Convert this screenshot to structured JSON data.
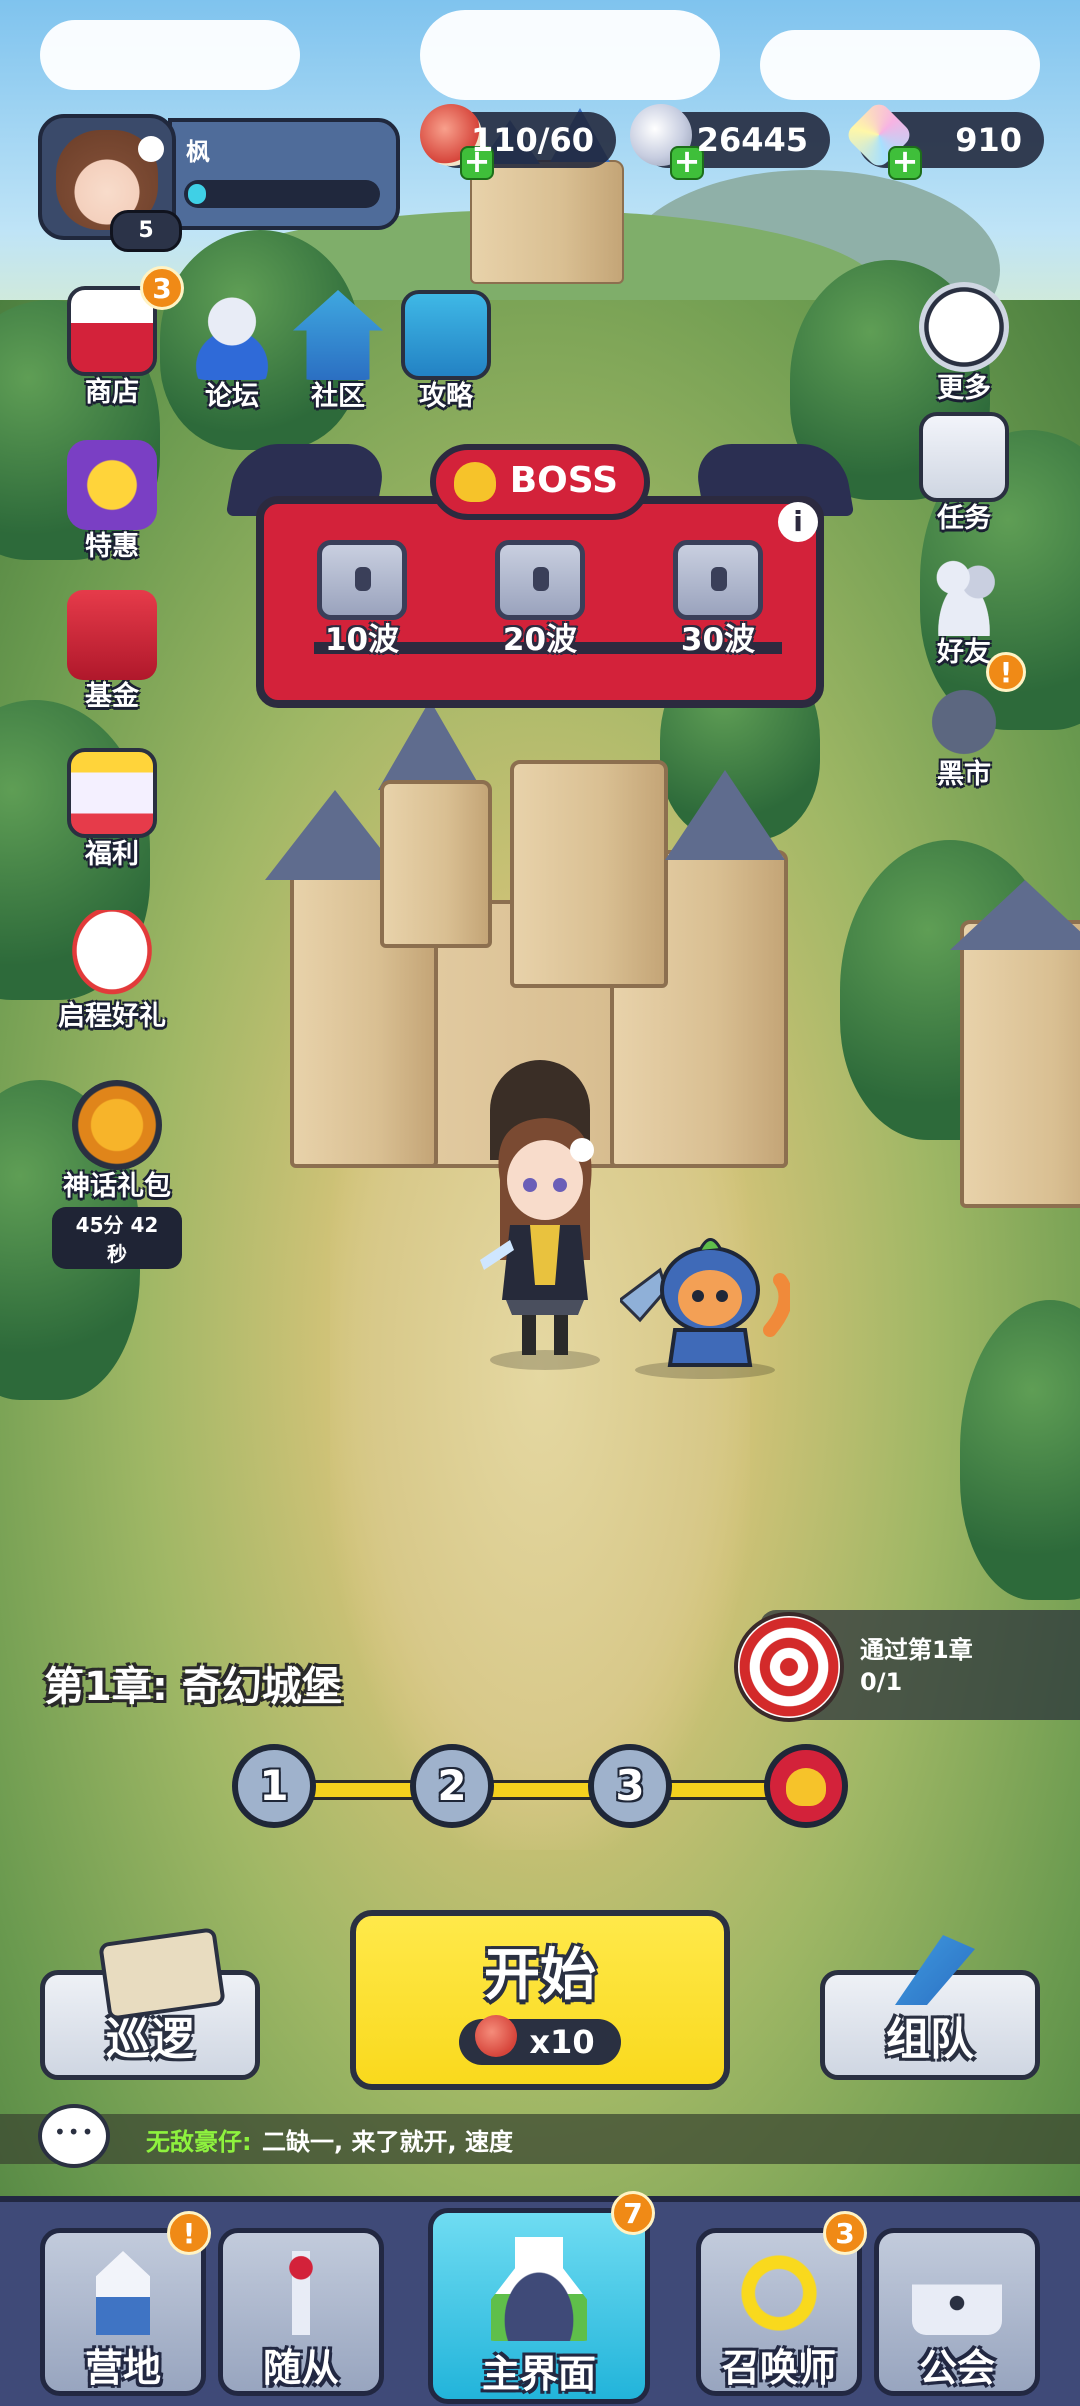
{
  "player": {
    "name": "枫",
    "level": "5",
    "xp_fraction": 0.06
  },
  "resources": [
    {
      "name": "stamina",
      "icon": "meat-icon",
      "value": "110/60",
      "color": "#d6443a"
    },
    {
      "name": "silver",
      "icon": "silver-ore-icon",
      "value": "26445",
      "color": "#cfd6e2"
    },
    {
      "name": "diamond",
      "icon": "diamond-icon",
      "value": "910",
      "color": "#f0a0d8"
    }
  ],
  "top_buttons": [
    {
      "label": "商店",
      "badge": "3"
    },
    {
      "label": "论坛"
    },
    {
      "label": "社区"
    },
    {
      "label": "攻略"
    }
  ],
  "left_buttons": [
    {
      "label": "特惠"
    },
    {
      "label": "基金"
    },
    {
      "label": "福利"
    },
    {
      "label": "启程好礼"
    },
    {
      "label": "神话礼包",
      "timer": "45分 42秒"
    }
  ],
  "right_buttons": [
    {
      "label": "更多"
    },
    {
      "label": "任务"
    },
    {
      "label": "好友"
    },
    {
      "label": "黑市",
      "badge": "!"
    }
  ],
  "boss_panel": {
    "title": "BOSS",
    "info": "i",
    "chests": [
      "10波",
      "20波",
      "30波"
    ]
  },
  "chapter": {
    "title": "第1章: 奇幻城堡",
    "stages": [
      "1",
      "2",
      "3"
    ],
    "current_boss_stage": true
  },
  "quest": {
    "text": "通过第1章",
    "progress": "0/1"
  },
  "actions": {
    "patrol": "巡逻",
    "start": "开始",
    "start_cost": "x10",
    "team": "组队"
  },
  "chat": {
    "sender": "无敌豪仔:",
    "message": "二缺一, 来了就开, 速度"
  },
  "nav": [
    {
      "label": "营地",
      "badge": "!"
    },
    {
      "label": "随从"
    },
    {
      "label": "主界面",
      "badge": "7",
      "active": true
    },
    {
      "label": "召唤师",
      "badge": "3"
    },
    {
      "label": "公会"
    }
  ],
  "colors": {
    "accent_yellow": "#f9d91d",
    "boss_red": "#d3223a",
    "nav_bg": "#3f4a78",
    "active_tab": "#22b4da"
  }
}
